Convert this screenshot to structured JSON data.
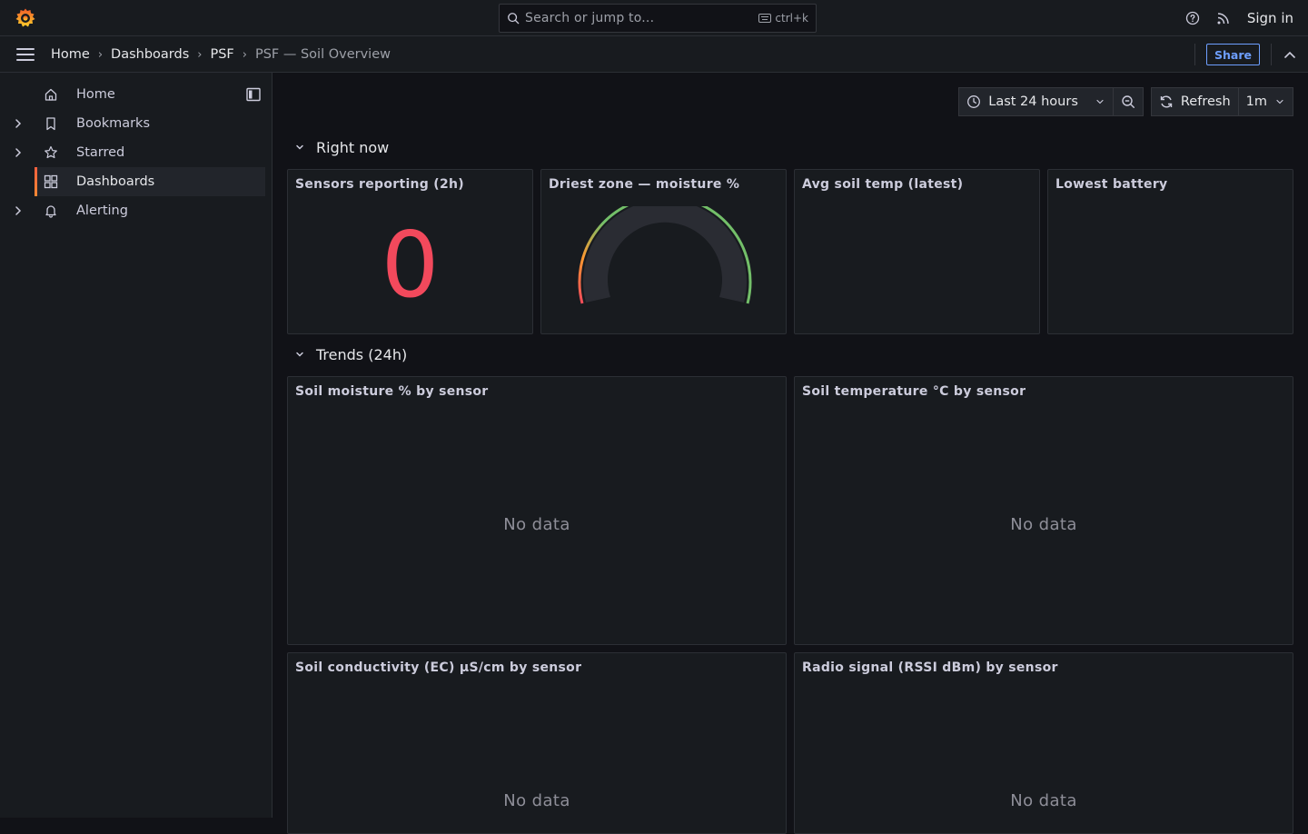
{
  "topbar": {
    "search_placeholder": "Search or jump to...",
    "search_shortcut": "ctrl+k",
    "sign_in": "Sign in"
  },
  "breadcrumbs": {
    "items": [
      "Home",
      "Dashboards",
      "PSF"
    ],
    "current": "PSF — Soil Overview",
    "share_label": "Share"
  },
  "sidebar": {
    "items": [
      {
        "label": "Home",
        "icon": "home-icon",
        "expandable": false,
        "active": false
      },
      {
        "label": "Bookmarks",
        "icon": "bookmark-icon",
        "expandable": true,
        "active": false
      },
      {
        "label": "Starred",
        "icon": "star-icon",
        "expandable": true,
        "active": false
      },
      {
        "label": "Dashboards",
        "icon": "dashboards-icon",
        "expandable": false,
        "active": true
      },
      {
        "label": "Alerting",
        "icon": "bell-icon",
        "expandable": true,
        "active": false
      }
    ]
  },
  "toolbar": {
    "time_range": "Last 24 hours",
    "refresh_label": "Refresh",
    "refresh_interval": "1m"
  },
  "rows": [
    {
      "title": "Right now"
    },
    {
      "title": "Trends (24h)"
    }
  ],
  "panels": {
    "sensors_reporting": {
      "title": "Sensors reporting (2h)",
      "value": "0",
      "color": "#f2495c"
    },
    "driest_zone": {
      "title": "Driest zone — moisture %",
      "gauge_colors": [
        "#f2495c",
        "#ff9830",
        "#73bf69"
      ]
    },
    "avg_soil_temp": {
      "title": "Avg soil temp (latest)"
    },
    "lowest_battery": {
      "title": "Lowest battery"
    },
    "soil_moisture": {
      "title": "Soil moisture % by sensor",
      "empty_text": "No data"
    },
    "soil_temperature": {
      "title": "Soil temperature °C by sensor",
      "empty_text": "No data"
    },
    "soil_conductivity": {
      "title": "Soil conductivity (EC) µS/cm by sensor",
      "empty_text": "No data"
    },
    "radio_signal": {
      "title": "Radio signal (RSSI dBm) by sensor",
      "empty_text": "No data"
    }
  },
  "colors": {
    "accent_blue": "#6e9fff",
    "brand_orange": "#f55f3e"
  }
}
